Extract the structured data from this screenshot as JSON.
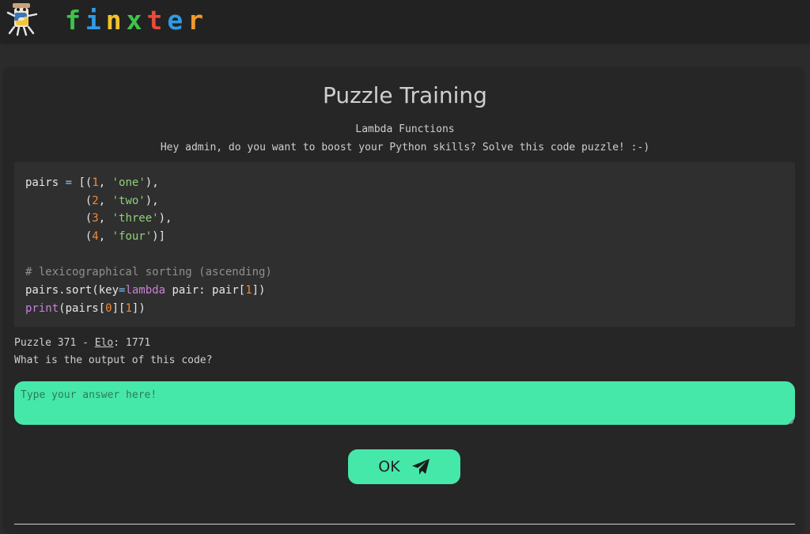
{
  "header": {
    "brand_letters": [
      {
        "char": "f",
        "color": "#3cc44a"
      },
      {
        "char": "i",
        "color": "#2f9be8"
      },
      {
        "char": "n",
        "color": "#f3c22a"
      },
      {
        "char": "x",
        "color": "#3cc44a"
      },
      {
        "char": "t",
        "color": "#e84b3a"
      },
      {
        "char": "e",
        "color": "#2f9be8"
      },
      {
        "char": "r",
        "color": "#f39a2a"
      }
    ],
    "mascot_icon": "python-mascot-icon"
  },
  "page": {
    "title": "Puzzle Training",
    "topic": "Lambda Functions",
    "intro": "Hey admin, do you want to boost your Python skills? Solve this code puzzle! :-)"
  },
  "code_lines": [
    [
      {
        "t": "pairs ",
        "c": ""
      },
      {
        "t": "=",
        "c": "op"
      },
      {
        "t": " [(",
        "c": ""
      },
      {
        "t": "1",
        "c": "num"
      },
      {
        "t": ", ",
        "c": ""
      },
      {
        "t": "'one'",
        "c": "str"
      },
      {
        "t": "),",
        "c": ""
      }
    ],
    [
      {
        "t": "         (",
        "c": ""
      },
      {
        "t": "2",
        "c": "num"
      },
      {
        "t": ", ",
        "c": ""
      },
      {
        "t": "'two'",
        "c": "str"
      },
      {
        "t": "),",
        "c": ""
      }
    ],
    [
      {
        "t": "         (",
        "c": ""
      },
      {
        "t": "3",
        "c": "num"
      },
      {
        "t": ", ",
        "c": ""
      },
      {
        "t": "'three'",
        "c": "str"
      },
      {
        "t": "),",
        "c": ""
      }
    ],
    [
      {
        "t": "         (",
        "c": ""
      },
      {
        "t": "4",
        "c": "num"
      },
      {
        "t": ", ",
        "c": ""
      },
      {
        "t": "'four'",
        "c": "str"
      },
      {
        "t": ")]",
        "c": ""
      }
    ],
    [],
    [
      {
        "t": "# lexicographical sorting (ascending)",
        "c": "com"
      }
    ],
    [
      {
        "t": "pairs.sort(key",
        "c": ""
      },
      {
        "t": "=",
        "c": "op"
      },
      {
        "t": "lambda",
        "c": "kw"
      },
      {
        "t": " pair: pair[",
        "c": ""
      },
      {
        "t": "1",
        "c": "num"
      },
      {
        "t": "])",
        "c": ""
      }
    ],
    [
      {
        "t": "print",
        "c": "kw"
      },
      {
        "t": "(pairs[",
        "c": ""
      },
      {
        "t": "0",
        "c": "num"
      },
      {
        "t": "][",
        "c": ""
      },
      {
        "t": "1",
        "c": "num"
      },
      {
        "t": "])",
        "c": ""
      }
    ]
  ],
  "puzzle": {
    "prefix": "Puzzle 371 - ",
    "elo_label": "Elo",
    "elo_suffix": ": 1771",
    "question": "What is the output of this code?"
  },
  "answer": {
    "value": "",
    "placeholder": "Type your answer here!"
  },
  "submit": {
    "label": "OK",
    "icon": "paper-plane-icon"
  }
}
